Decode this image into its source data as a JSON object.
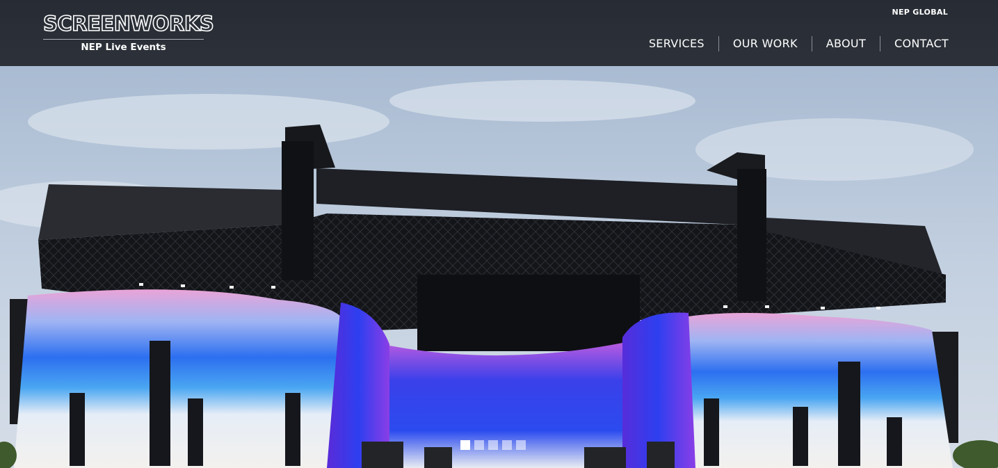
{
  "brand": {
    "logo_text": "SCREENWORKS",
    "logo_subtitle": "NEP Live Events"
  },
  "utility_nav": {
    "label": "NEP GLOBAL"
  },
  "nav": {
    "items": [
      {
        "label": "SERVICES"
      },
      {
        "label": "OUR WORK"
      },
      {
        "label": "ABOUT"
      },
      {
        "label": "CONTACT"
      }
    ]
  },
  "hero": {
    "slide_count": 5,
    "active_slide": 1
  },
  "colors": {
    "header_bg": "#2b3038",
    "text": "#ffffff",
    "sky": "#b9c8db",
    "screen_blue": "#2a3df0",
    "screen_pink": "#e07adf"
  }
}
